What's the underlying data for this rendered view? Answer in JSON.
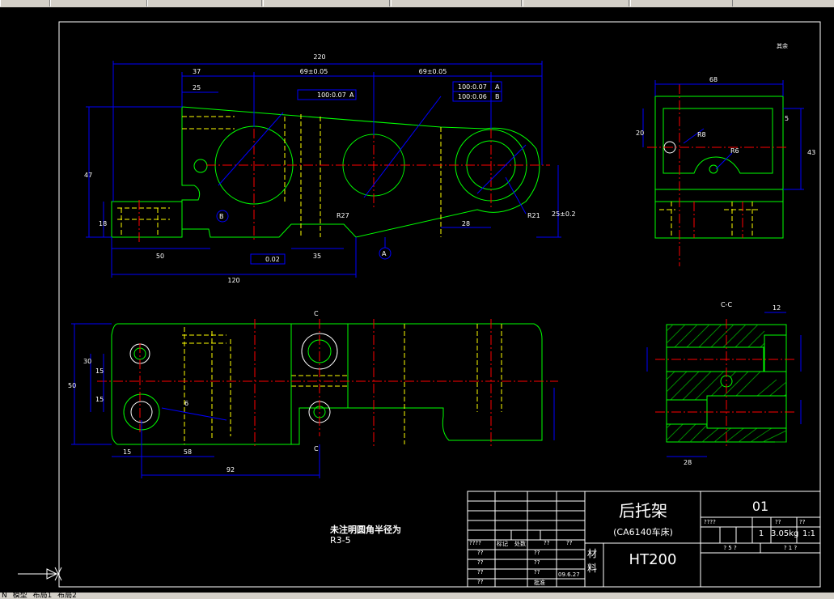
{
  "drawing": {
    "part_name": "后托架",
    "machine": "(CA6140车床)",
    "drawing_no": "01",
    "material_label": "材料",
    "material": "HT200",
    "weight": "3.05kg",
    "scale": "1:1",
    "quantity": "1",
    "date": "09.6.27",
    "note_line1": "未注明圆角半径为",
    "note_line2": "R3-5",
    "section_label": "C-C",
    "roughness_note": "其余"
  },
  "dims_front": {
    "total": "220",
    "d37": "37",
    "d69a": "69±0.05",
    "d69b": "69±0.05",
    "d25": "25",
    "d47": "47",
    "d18": "18",
    "d50": "50",
    "d120": "120",
    "d35": "35",
    "d28": "28",
    "d25b": "25±0.2",
    "tol1": "100:0.07",
    "tol1_ref": "A",
    "tol2": "100:0.07",
    "tol2_ref": "A",
    "tol3": "100:0.06",
    "tol3_ref": "B",
    "flat": "0.02",
    "datum_a": "A",
    "datum_b": "B",
    "r27": "R27",
    "r21": "R21"
  },
  "dims_side": {
    "d68": "68",
    "d43": "43",
    "d5": "5",
    "d20": "20",
    "r8": "R8",
    "r6": "R6"
  },
  "dims_top": {
    "d92": "92",
    "d58": "58",
    "d15": "15",
    "d30": "30",
    "d50": "50",
    "d15b": "15",
    "d15c": "15",
    "d6": "6",
    "cut": "C"
  },
  "dims_section": {
    "d12": "12",
    "d28": "28"
  },
  "title_block": {
    "row_labels": [
      "????",
      "标记",
      "处数",
      "??",
      "??"
    ],
    "left_rows": [
      "??",
      "??",
      "??",
      "??"
    ],
    "left_rows2": [
      "??",
      "??",
      "??",
      "批准"
    ],
    "stage_labels": [
      "????",
      "??",
      "??",
      "??"
    ],
    "sheet_left": "? 5 ?",
    "sheet_right": "? 1 ?"
  },
  "tabs": [
    "N",
    "模型",
    "布局1",
    "布局2"
  ]
}
